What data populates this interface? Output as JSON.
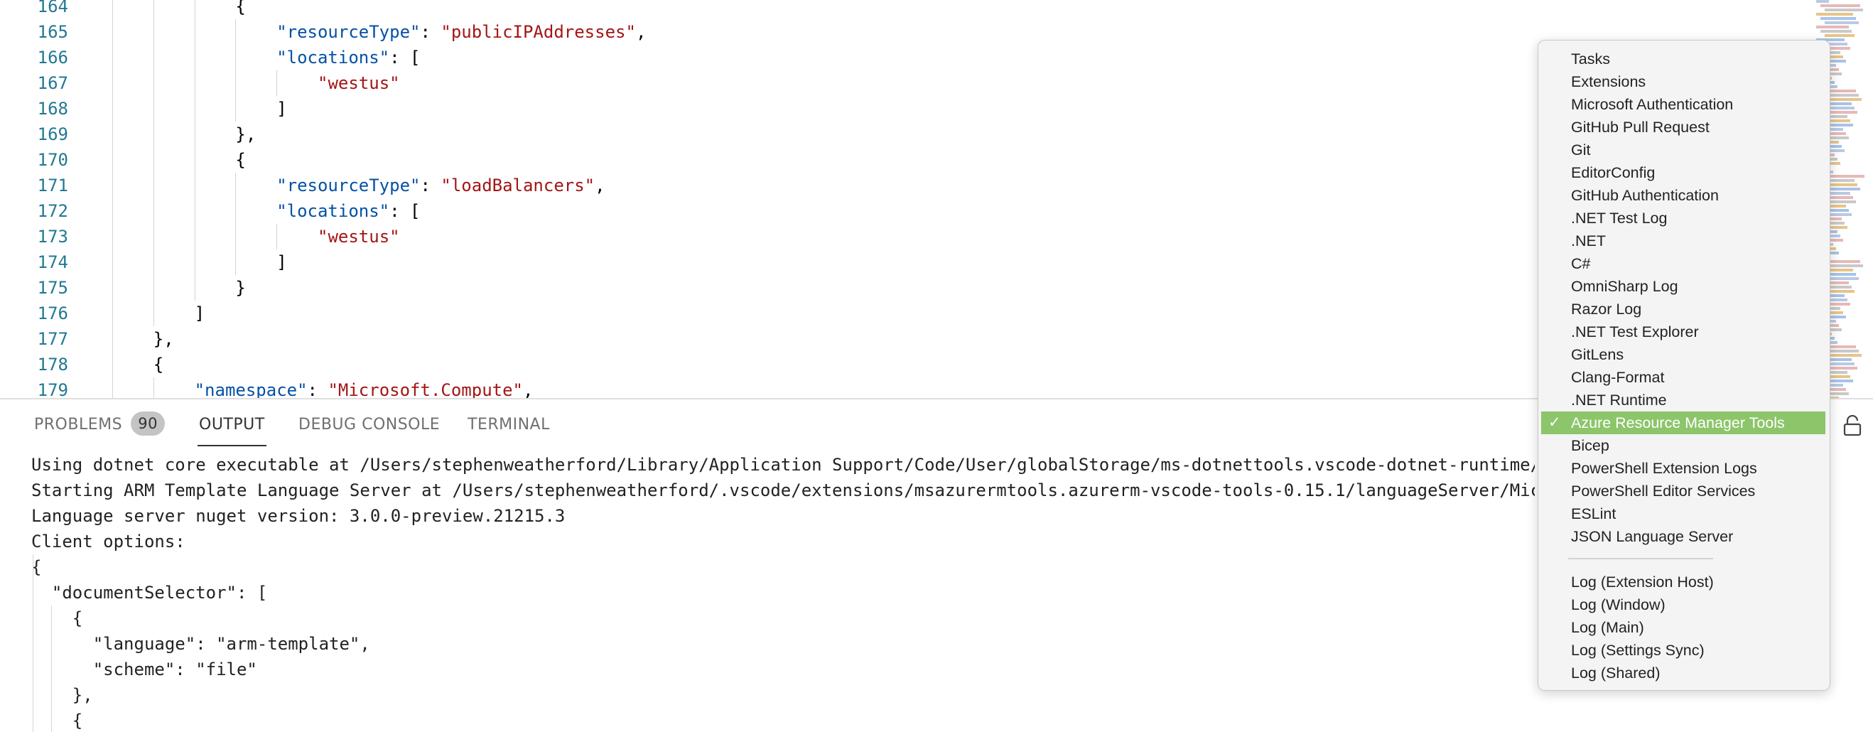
{
  "editor": {
    "lines": [
      {
        "n": "164",
        "indent": 3,
        "tokens": [
          [
            "p",
            "{"
          ]
        ]
      },
      {
        "n": "165",
        "indent": 4,
        "tokens": [
          [
            "k",
            "\"resourceType\""
          ],
          [
            "p",
            ": "
          ],
          [
            "s",
            "\"publicIPAddresses\""
          ],
          [
            "p",
            ","
          ]
        ]
      },
      {
        "n": "166",
        "indent": 4,
        "tokens": [
          [
            "k",
            "\"locations\""
          ],
          [
            "p",
            ": ["
          ]
        ]
      },
      {
        "n": "167",
        "indent": 5,
        "tokens": [
          [
            "s",
            "\"westus\""
          ]
        ]
      },
      {
        "n": "168",
        "indent": 4,
        "tokens": [
          [
            "p",
            "]"
          ]
        ]
      },
      {
        "n": "169",
        "indent": 3,
        "tokens": [
          [
            "p",
            "},"
          ]
        ]
      },
      {
        "n": "170",
        "indent": 3,
        "tokens": [
          [
            "p",
            "{"
          ]
        ]
      },
      {
        "n": "171",
        "indent": 4,
        "tokens": [
          [
            "k",
            "\"resourceType\""
          ],
          [
            "p",
            ": "
          ],
          [
            "s",
            "\"loadBalancers\""
          ],
          [
            "p",
            ","
          ]
        ]
      },
      {
        "n": "172",
        "indent": 4,
        "tokens": [
          [
            "k",
            "\"locations\""
          ],
          [
            "p",
            ": ["
          ]
        ]
      },
      {
        "n": "173",
        "indent": 5,
        "tokens": [
          [
            "s",
            "\"westus\""
          ]
        ]
      },
      {
        "n": "174",
        "indent": 4,
        "tokens": [
          [
            "p",
            "]"
          ]
        ]
      },
      {
        "n": "175",
        "indent": 3,
        "tokens": [
          [
            "p",
            "}"
          ]
        ]
      },
      {
        "n": "176",
        "indent": 2,
        "tokens": [
          [
            "p",
            "]"
          ]
        ]
      },
      {
        "n": "177",
        "indent": 1,
        "tokens": [
          [
            "p",
            "},"
          ]
        ]
      },
      {
        "n": "178",
        "indent": 1,
        "tokens": [
          [
            "p",
            "{"
          ]
        ]
      },
      {
        "n": "179",
        "indent": 2,
        "tokens": [
          [
            "k",
            "\"namespace\""
          ],
          [
            "p",
            ": "
          ],
          [
            "s",
            "\"Microsoft.Compute\""
          ],
          [
            "p",
            ","
          ]
        ]
      }
    ]
  },
  "panel": {
    "tabs": {
      "problems": "PROBLEMS",
      "problems_count": "90",
      "output": "OUTPUT",
      "debug_console": "DEBUG CONSOLE",
      "terminal": "TERMINAL"
    },
    "active_tab": "OUTPUT",
    "output_lines": [
      "Using dotnet core executable at /Users/stephenweatherford/Library/Application Support/Code/User/globalStorage/ms-dotnettools.vscode-dotnet-runtime/",
      "Starting ARM Template Language Server at /Users/stephenweatherford/.vscode/extensions/msazurermtools.azurerm-vscode-tools-0.15.1/languageServer/Mic",
      "Language server nuget version: 3.0.0-preview.21215.3",
      "Client options:",
      "{",
      "  \"documentSelector\": [",
      "    {",
      "      \"language\": \"arm-template\",",
      "      \"scheme\": \"file\"",
      "    },",
      "    {"
    ]
  },
  "output_channel_menu": {
    "selected": "Azure Resource Manager Tools",
    "items": [
      "Tasks",
      "Extensions",
      "Microsoft Authentication",
      "GitHub Pull Request",
      "Git",
      "EditorConfig",
      "GitHub Authentication",
      ".NET Test Log",
      ".NET",
      "C#",
      "OmniSharp Log",
      "Razor Log",
      ".NET Test Explorer",
      "GitLens",
      "Clang-Format",
      ".NET Runtime",
      "Azure Resource Manager Tools",
      "Bicep",
      "PowerShell Extension Logs",
      "PowerShell Editor Services",
      "ESLint",
      "JSON Language Server"
    ],
    "log_items": [
      "Log (Extension Host)",
      "Log (Window)",
      "Log (Main)",
      "Log (Settings Sync)",
      "Log (Shared)"
    ]
  },
  "colors": {
    "line_number": "#237893",
    "json_key": "#0451a5",
    "json_string": "#a31515",
    "selection": "#8cc56a"
  },
  "icons": {
    "lock": "lock-icon",
    "check": "checkmark-icon"
  }
}
